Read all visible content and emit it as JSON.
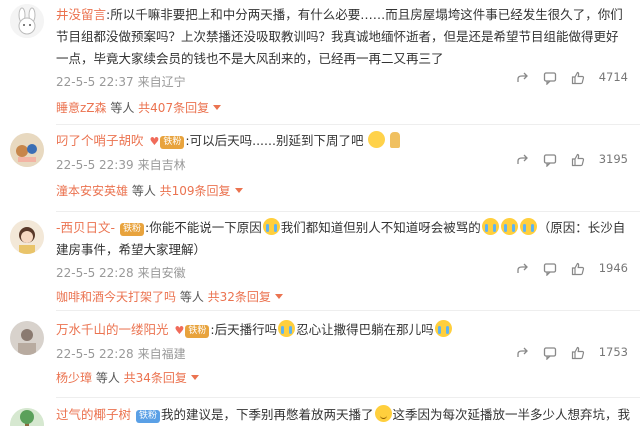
{
  "comments": [
    {
      "name": "井没留言",
      "text": ":所以千嘛非要把上和中分两天播，有什么必要……而且房屋塌垮这件事已经发生很久了，你们节目组都没做预案吗？上次禁播还没吸取教训吗？我真诚地缅怀逝者，但是还是希望节目组能做得更好一点，毕竟大家续会员的钱也不是大风刮来的，已经再一再二又再三了",
      "time": "22-5-5 22:37",
      "location": "来自辽宁",
      "likes": "4714",
      "reply_name": "睡意zZ森",
      "reply_mid": " 等人 ",
      "reply_count": "共407条回复"
    },
    {
      "name": "叼了个哨子胡吹",
      "badge": "铁粉",
      "text": ":可以后天吗......别延到下周了吧",
      "time": "22-5-5 22:39",
      "location": "来自吉林",
      "likes": "3195",
      "reply_name": "潼本安安英雄",
      "reply_mid": " 等人 ",
      "reply_count": "共109条回复"
    },
    {
      "name": "-西贝日文-",
      "badge": "铁粉",
      "text_a": ":你能不能说一下原因",
      "text_b": "我们都知道但别人不知道呀会被骂的",
      "text_c": "（原因：长沙自建房事件，希望大家理解）",
      "time": "22-5-5 22:28",
      "location": "来自安徽",
      "likes": "1946",
      "reply_name": "咖啡和酒今天打架了吗",
      "reply_mid": " 等人 ",
      "reply_count": "共32条回复"
    },
    {
      "name": "万水千山的一缕阳光",
      "badge": "铁粉",
      "text_a": ":后天播行吗",
      "text_b": "忍心让撒得巴躺在那儿吗",
      "time": "22-5-5 22:28",
      "location": "来自福建",
      "likes": "1753",
      "reply_name": "杨少璋",
      "reply_mid": " 等人 ",
      "reply_count": "共34条回复"
    },
    {
      "name": "过气的椰子树",
      "badge": "铁粉",
      "text_a": "我的建议是，下季别再憋着放两天播了",
      "text_b": "这季因为每次延播放一半多少人想弃坑，我"
    }
  ],
  "icons": {
    "share": "share-icon",
    "comment": "comment-icon",
    "like": "thumbs-up-icon"
  },
  "colors": {
    "username": "#eb7350",
    "meta": "#999999",
    "badge": "#e8a33d"
  }
}
